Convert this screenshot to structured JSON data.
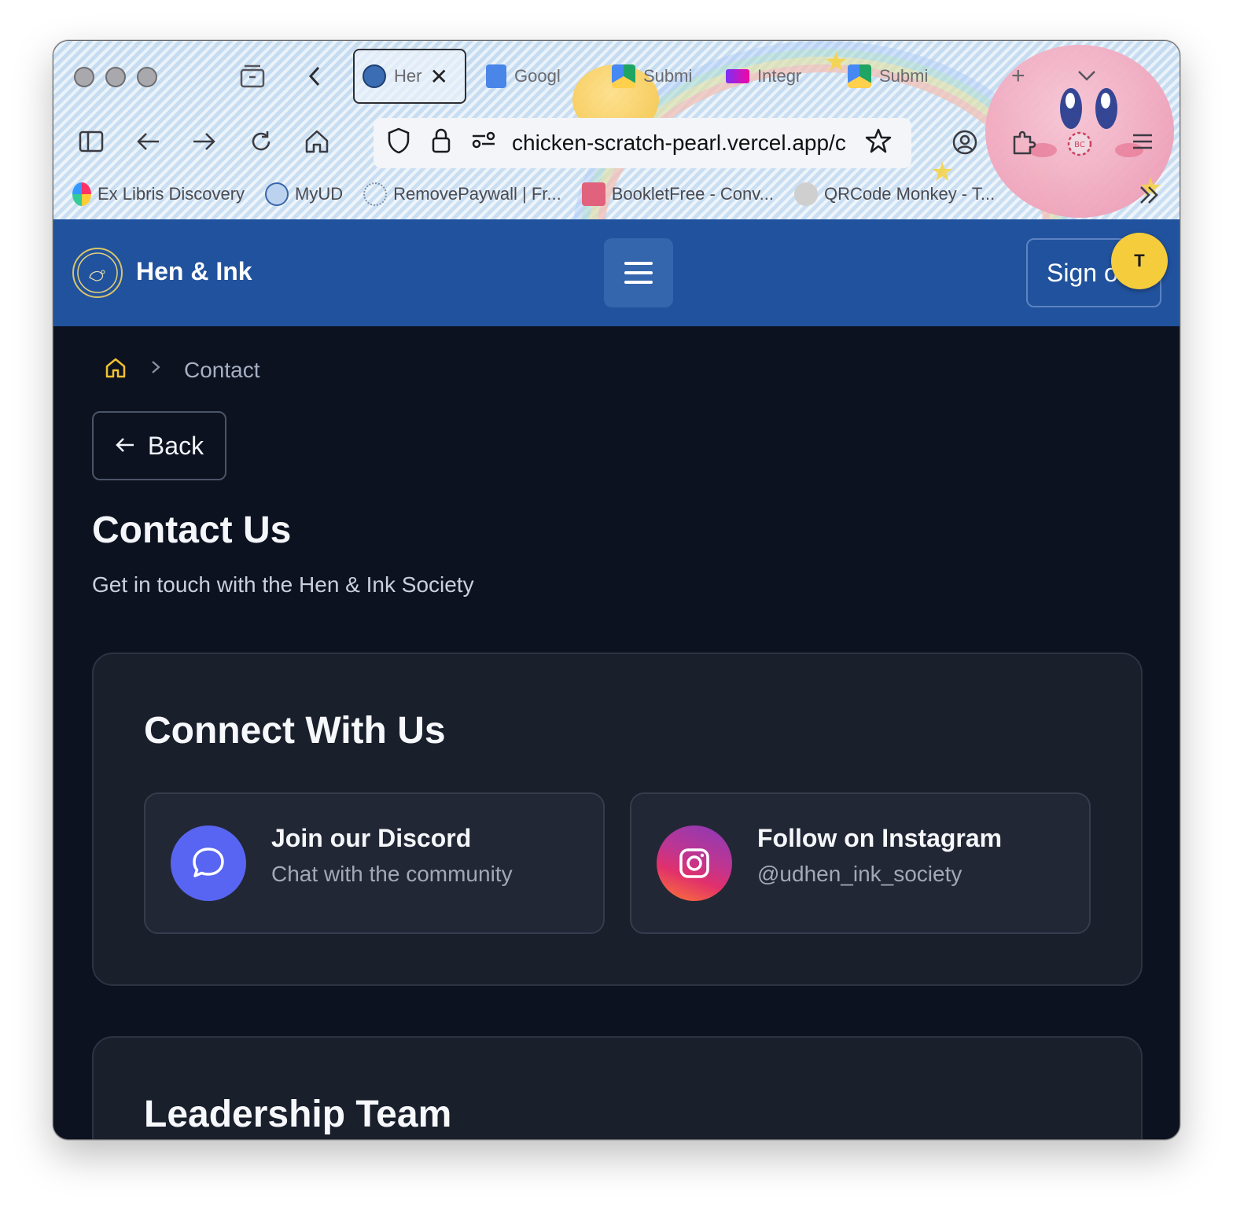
{
  "browser": {
    "tabs": [
      {
        "label": "Her",
        "active": true
      },
      {
        "label": "Googl"
      },
      {
        "label": "Submi"
      },
      {
        "label": "Integr"
      },
      {
        "label": "Submi"
      }
    ],
    "url": "chicken-scratch-pearl.vercel.app/c",
    "bookmarks": [
      {
        "label": "Ex Libris Discovery"
      },
      {
        "label": "MyUD"
      },
      {
        "label": "RemovePaywall | Fr..."
      },
      {
        "label": "BookletFree - Conv..."
      },
      {
        "label": "QRCode Monkey - T..."
      }
    ]
  },
  "header": {
    "brand": "Hen & Ink",
    "logo_text": "Hen & Ink Society",
    "signin_label": "Sign o",
    "avatar_initial": "T"
  },
  "breadcrumb": {
    "current": "Contact"
  },
  "back_label": "Back",
  "page": {
    "title": "Contact Us",
    "subtitle": "Get in touch with the Hen & Ink Society"
  },
  "connect": {
    "title": "Connect With Us",
    "discord": {
      "title": "Join our Discord",
      "subtitle": "Chat with the community"
    },
    "instagram": {
      "title": "Follow on Instagram",
      "subtitle": "@udhen_ink_society"
    }
  },
  "leadership": {
    "title": "Leadership Team"
  },
  "colors": {
    "header_bg": "#21529d",
    "page_bg": "#0d1221",
    "card_bg": "#1a1f2c",
    "discord": "#5865f2",
    "avatar": "#f5cc3c"
  }
}
